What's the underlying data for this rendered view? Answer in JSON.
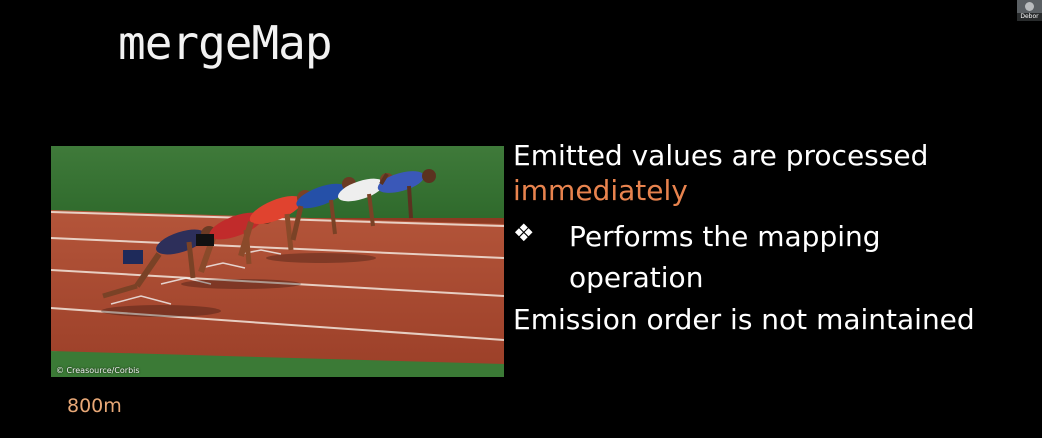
{
  "slide": {
    "title": "mergeMap",
    "photo": {
      "description": "sprinters at starting blocks on a running track",
      "credit": "© Creasource/Corbis",
      "caption": "800m"
    },
    "bullets": {
      "line1": "Emitted values are processed",
      "line1_accent": "immediately",
      "sub_marker": "❖",
      "sub_line1": "Performs the mapping",
      "sub_line2": "operation",
      "line_last": "Emission order is not maintained"
    }
  },
  "participant": {
    "name": "Debor"
  },
  "colors": {
    "background": "#000000",
    "text": "#ffffff",
    "accent": "#e8834e",
    "caption": "#e8a877"
  }
}
